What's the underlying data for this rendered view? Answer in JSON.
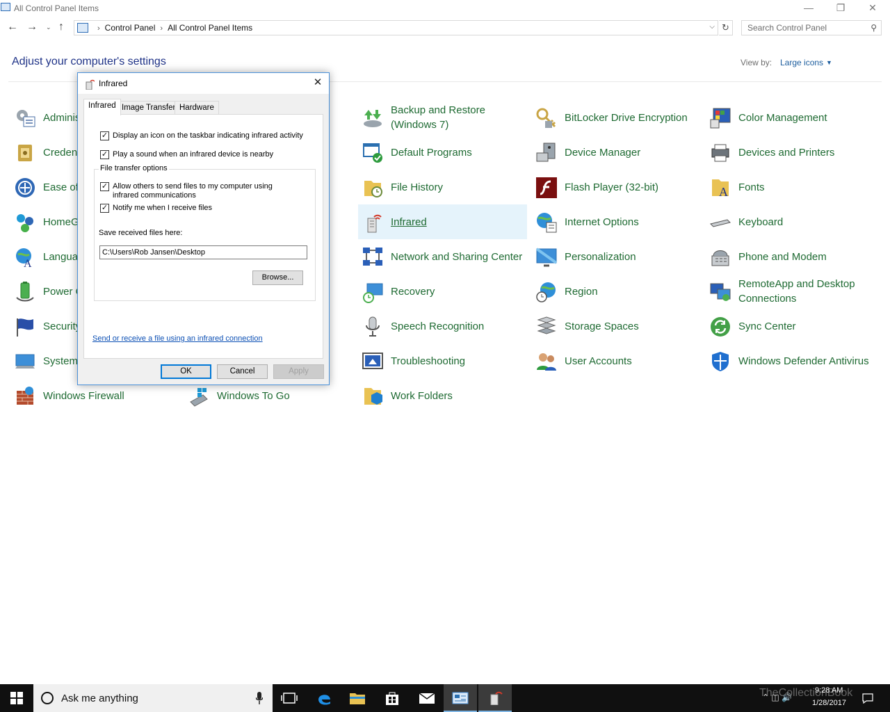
{
  "window": {
    "title": "All Control Panel Items",
    "minimize": "—",
    "restore": "❐",
    "close": "✕"
  },
  "nav": {
    "back": "←",
    "forward": "→",
    "recent": "⌄",
    "up": "↑",
    "refresh": "↻"
  },
  "address": {
    "crumbs": [
      "Control Panel",
      "All Control Panel Items"
    ],
    "separator": "›"
  },
  "search": {
    "placeholder": "Search Control Panel"
  },
  "header": {
    "heading": "Adjust your computer's settings",
    "view_by_label": "View by:",
    "view_by_value": "Large icons"
  },
  "items": {
    "admin": "Administrative Tools",
    "credential": "Credential Manager",
    "ease": "Ease of Access Center",
    "homegroup": "HomeGroup",
    "language": "Language",
    "power": "Power Options",
    "security": "Security and Maintenance",
    "system": "System",
    "firewall": "Windows Firewall",
    "windows_to_go": "Windows To Go",
    "backup": "Backup and Restore (Windows 7)",
    "default_programs": "Default Programs",
    "file_history": "File History",
    "infrared": "Infrared",
    "network": "Network and Sharing Center",
    "recovery": "Recovery",
    "speech": "Speech Recognition",
    "troubleshooting": "Troubleshooting",
    "work_folders": "Work Folders",
    "bitlocker": "BitLocker Drive Encryption",
    "device_manager": "Device Manager",
    "flash": "Flash Player (32-bit)",
    "internet_options": "Internet Options",
    "personalization": "Personalization",
    "region": "Region",
    "storage": "Storage Spaces",
    "user_accounts": "User Accounts",
    "color": "Color Management",
    "devices_printers": "Devices and Printers",
    "fonts": "Fonts",
    "keyboard": "Keyboard",
    "phone_modem": "Phone and Modem",
    "remoteapp": "RemoteApp and Desktop Connections",
    "sync": "Sync Center",
    "defender": "Windows Defender Antivirus"
  },
  "dialog": {
    "title": "Infrared",
    "close": "✕",
    "tabs": [
      "Infrared",
      "Image Transfer",
      "Hardware"
    ],
    "check_taskbar": "Display an icon on the taskbar indicating infrared activity",
    "check_sound": "Play a sound when an infrared device is nearby",
    "group_title": "File transfer options",
    "check_allow": "Allow others to send files to my computer using infrared communications",
    "check_notify": "Notify me when I receive files",
    "check_mark": "✓",
    "save_label": "Save received files here:",
    "save_path": "C:\\Users\\Rob Jansen\\Desktop",
    "browse": "Browse...",
    "link": "Send or receive a file using an infrared connection",
    "ok": "OK",
    "cancel": "Cancel",
    "apply": "Apply"
  },
  "taskbar": {
    "search_text": "Ask me anything",
    "time": "9:28 AM",
    "date": "1/28/2017",
    "watermark": "TheCollectionBook"
  },
  "colors": {
    "link_green": "#1e6a32",
    "heading_blue": "#1e3287",
    "accent": "#0078d7"
  }
}
